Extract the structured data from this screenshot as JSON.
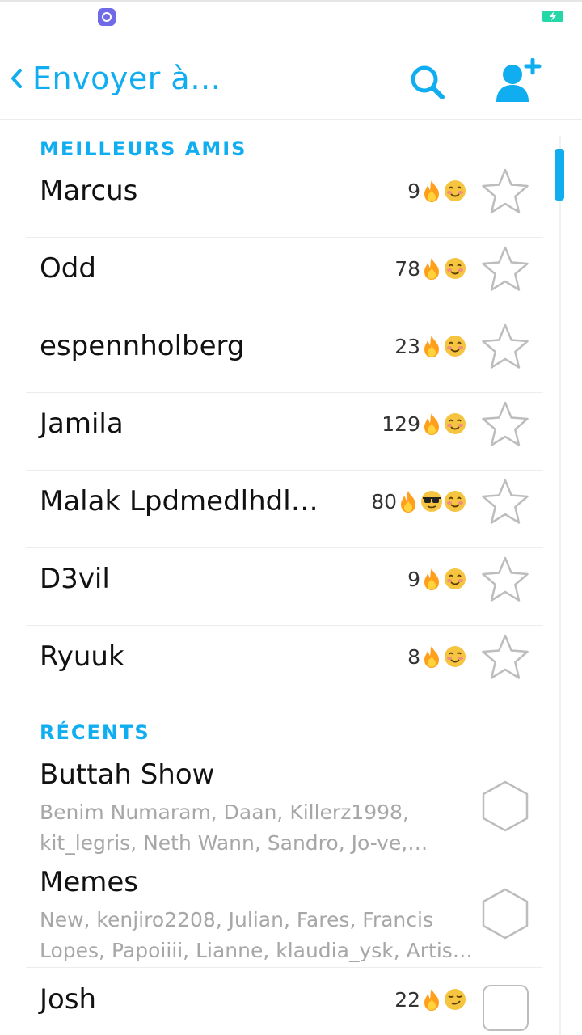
{
  "header": {
    "title": "Envoyer à…",
    "back_icon": "chevron-left-icon",
    "search_icon": "search-icon",
    "add_friend_icon": "add-friend-icon",
    "accent_color": "#10adf0"
  },
  "best_friends": {
    "title": "MEILLEURS AMIS",
    "items": [
      {
        "name": "Marcus",
        "streak": "9",
        "emojis": [
          "fire",
          "smile"
        ]
      },
      {
        "name": "Odd",
        "streak": "78",
        "emojis": [
          "fire",
          "smile"
        ]
      },
      {
        "name": "espennholberg",
        "streak": "23",
        "emojis": [
          "fire",
          "smile"
        ]
      },
      {
        "name": "Jamila",
        "streak": "129",
        "emojis": [
          "fire",
          "smile"
        ]
      },
      {
        "name": "Malak Lpdmedlhdl…",
        "streak": "80",
        "emojis": [
          "fire",
          "sunglasses",
          "smile"
        ]
      },
      {
        "name": "D3vil",
        "streak": "9",
        "emojis": [
          "fire",
          "smile"
        ]
      },
      {
        "name": "Ryuuk",
        "streak": "8",
        "emojis": [
          "fire",
          "smile"
        ]
      }
    ]
  },
  "recents": {
    "title": "RÉCENTS",
    "groups": [
      {
        "name": "Buttah Show",
        "members": "Benim Numaram, Daan, Killerz1998, kit_legris, Neth Wann, Sandro, Jo-ve,…"
      },
      {
        "name": "Memes",
        "members": "New, kenjiro2208, Julian, Fares, Francis Lopes, Papoiiii, Lianne, klaudia_ysk, Artis…"
      }
    ],
    "friends": [
      {
        "name": "Josh",
        "streak": "22",
        "emojis": [
          "fire",
          "smirk"
        ]
      }
    ]
  }
}
